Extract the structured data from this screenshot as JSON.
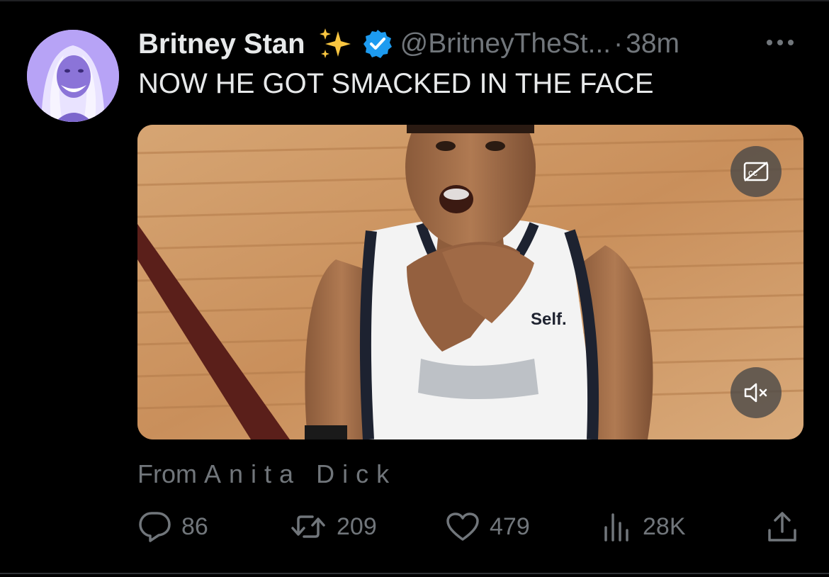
{
  "tweet": {
    "author_name": "Britney Stan",
    "emoji": "✨",
    "handle": "@BritneyTheSt...",
    "dot": "·",
    "time": "38m",
    "text": "NOW HE GOT SMACKED IN THE FACE",
    "media": {
      "jersey_text": "Self.",
      "cc_icon": "closed-captions-off-icon",
      "mute_icon": "speaker-muted-icon"
    },
    "source_prefix": "From",
    "source_name": "Anita  Dick"
  },
  "actions": {
    "replies": "86",
    "reposts": "209",
    "likes": "479",
    "views": "28K"
  },
  "colors": {
    "background": "#000000",
    "text": "#e7e9ea",
    "muted": "#71767b",
    "verified": "#1d9bf0"
  }
}
